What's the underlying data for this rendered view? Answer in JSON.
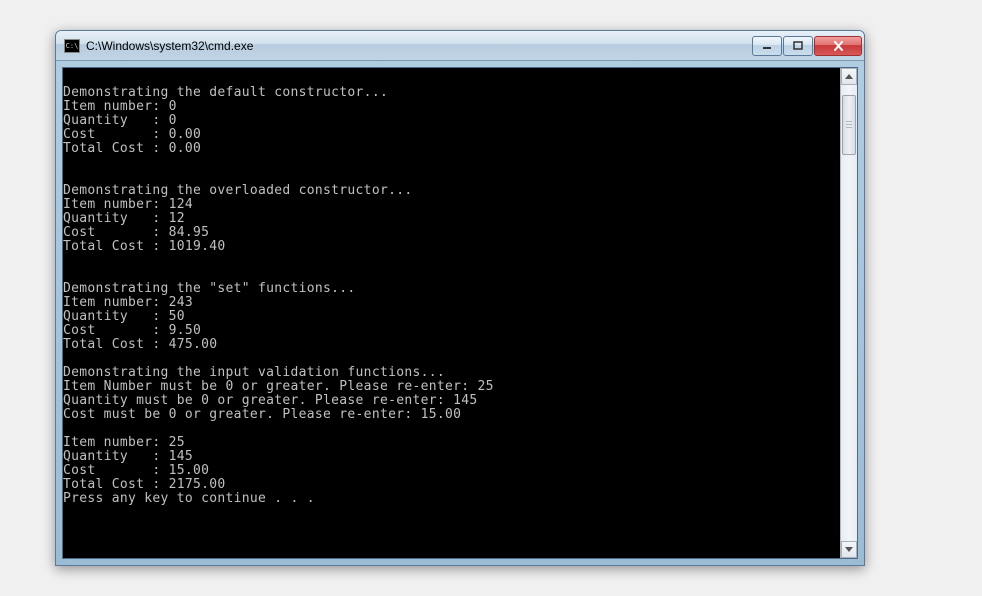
{
  "window": {
    "title": "C:\\Windows\\system32\\cmd.exe",
    "icon_label": "C:\\"
  },
  "controls": {
    "minimize": "minimize",
    "maximize": "maximize",
    "close": "close"
  },
  "console": {
    "lines": [
      "",
      "Demonstrating the default constructor...",
      "Item number: 0",
      "Quantity   : 0",
      "Cost       : 0.00",
      "Total Cost : 0.00",
      "",
      "",
      "Demonstrating the overloaded constructor...",
      "Item number: 124",
      "Quantity   : 12",
      "Cost       : 84.95",
      "Total Cost : 1019.40",
      "",
      "",
      "Demonstrating the \"set\" functions...",
      "Item number: 243",
      "Quantity   : 50",
      "Cost       : 9.50",
      "Total Cost : 475.00",
      "",
      "Demonstrating the input validation functions...",
      "Item Number must be 0 or greater. Please re-enter: 25",
      "Quantity must be 0 or greater. Please re-enter: 145",
      "Cost must be 0 or greater. Please re-enter: 15.00",
      "",
      "Item number: 25",
      "Quantity   : 145",
      "Cost       : 15.00",
      "Total Cost : 2175.00",
      "Press any key to continue . . ."
    ]
  }
}
